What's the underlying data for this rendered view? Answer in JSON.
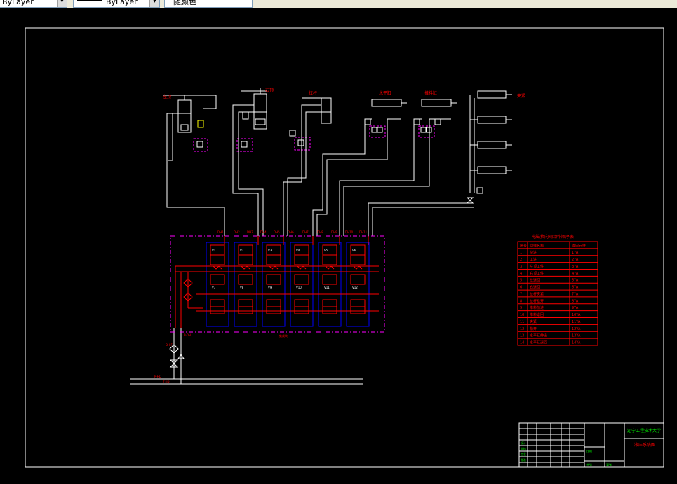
{
  "toolbar": {
    "layer_dropdown": "ByLayer",
    "linetype_dropdown": "ByLayer",
    "color_dropdown": "随颜色"
  },
  "drawing": {
    "actuators": [
      {
        "id": "act1",
        "label": "左顶"
      },
      {
        "id": "act2",
        "label": "右顶"
      },
      {
        "id": "act3",
        "label": "拉杆"
      },
      {
        "id": "act4",
        "label": "水平缸"
      },
      {
        "id": "act5",
        "label": "推料缸"
      },
      {
        "id": "act6",
        "label": "夹紧"
      }
    ],
    "port_labels": [
      "DH1",
      "DH2",
      "DH3",
      "DH4",
      "DH5",
      "DH6",
      "DH7",
      "DH8",
      "DH9",
      "DH10",
      "DH11"
    ],
    "manifold_label": "集成块",
    "inlet_label": "P-DH",
    "pressure_line_label": "P-HD",
    "return_line_label": "T-HD",
    "filter_label": "DH-F",
    "valve_labels": [
      "V1",
      "V2",
      "V3",
      "V4",
      "V5",
      "V6"
    ],
    "lower_valve_labels": [
      "V7",
      "V8",
      "V9",
      "V10",
      "V11",
      "V12"
    ]
  },
  "legend_table": {
    "title": "电磁换向阀动作顺序表",
    "header": [
      "序号",
      "动作名称",
      "得电元件"
    ],
    "rows": [
      [
        "1",
        "快进",
        "1YA"
      ],
      [
        "2",
        "工进",
        "2YA"
      ],
      [
        "3",
        "左顶工件",
        "3YA"
      ],
      [
        "4",
        "右顶工件",
        "4YA"
      ],
      [
        "5",
        "左退回",
        "5YA"
      ],
      [
        "6",
        "右退回",
        "6YA"
      ],
      [
        "7",
        "拉杆夹紧",
        "7YA"
      ],
      [
        "8",
        "拉杆松开",
        "8YA"
      ],
      [
        "9",
        "推料前进",
        "9YA"
      ],
      [
        "10",
        "推料退回",
        "10YA"
      ],
      [
        "11",
        "夹紧",
        "11YA"
      ],
      [
        "12",
        "松开",
        "12YA"
      ],
      [
        "13",
        "水平缸伸出",
        "13YA"
      ],
      [
        "14",
        "水平缸退回",
        "14YA"
      ]
    ]
  },
  "title_block": {
    "school": "辽宁工程技术大学",
    "drawing_name": "液压系统图",
    "fields": [
      "设计",
      "审核",
      "工艺",
      "批准"
    ],
    "sheet_info": [
      "共张",
      "第张"
    ],
    "scale_label": "比例"
  },
  "colors": {
    "background": "#000000",
    "frame": "#ffffff",
    "hydraulic_red": "#ff0000",
    "valve_blue": "#0000ff",
    "magenta": "#ff00ff",
    "table_green": "#00ff00"
  }
}
